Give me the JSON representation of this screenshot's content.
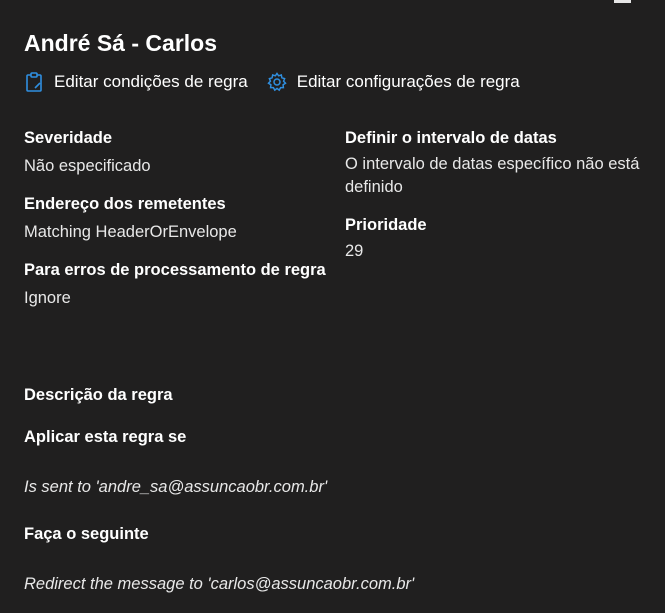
{
  "header": {
    "title": "André Sá - Carlos"
  },
  "actions": {
    "edit_conditions": {
      "label": "Editar condições de regra",
      "icon": "clipboard-icon"
    },
    "edit_settings": {
      "label": "Editar configurações de regra",
      "icon": "gear-icon"
    }
  },
  "colors": {
    "background": "#201f1f",
    "accent": "#2f8fe0",
    "text": "#ffffff"
  },
  "details": {
    "severity": {
      "label": "Severidade",
      "value": "Não especificado"
    },
    "sender_address": {
      "label": "Endereço dos remetentes",
      "value": "Matching HeaderOrEnvelope"
    },
    "processing_errors": {
      "label": "Para erros de processamento de regra",
      "value": "Ignore"
    },
    "date_range": {
      "label": "Definir o intervalo de datas",
      "value": "O intervalo de datas específico não está definido"
    },
    "priority": {
      "label": "Prioridade",
      "value": "29"
    }
  },
  "description": {
    "heading": "Descrição da regra",
    "if_label": "Aplicar esta regra se",
    "condition": "Is sent to 'andre_sa@assuncaobr.com.br'",
    "do_label": "Faça o seguinte",
    "action": "Redirect the message to 'carlos@assuncaobr.com.br'"
  }
}
